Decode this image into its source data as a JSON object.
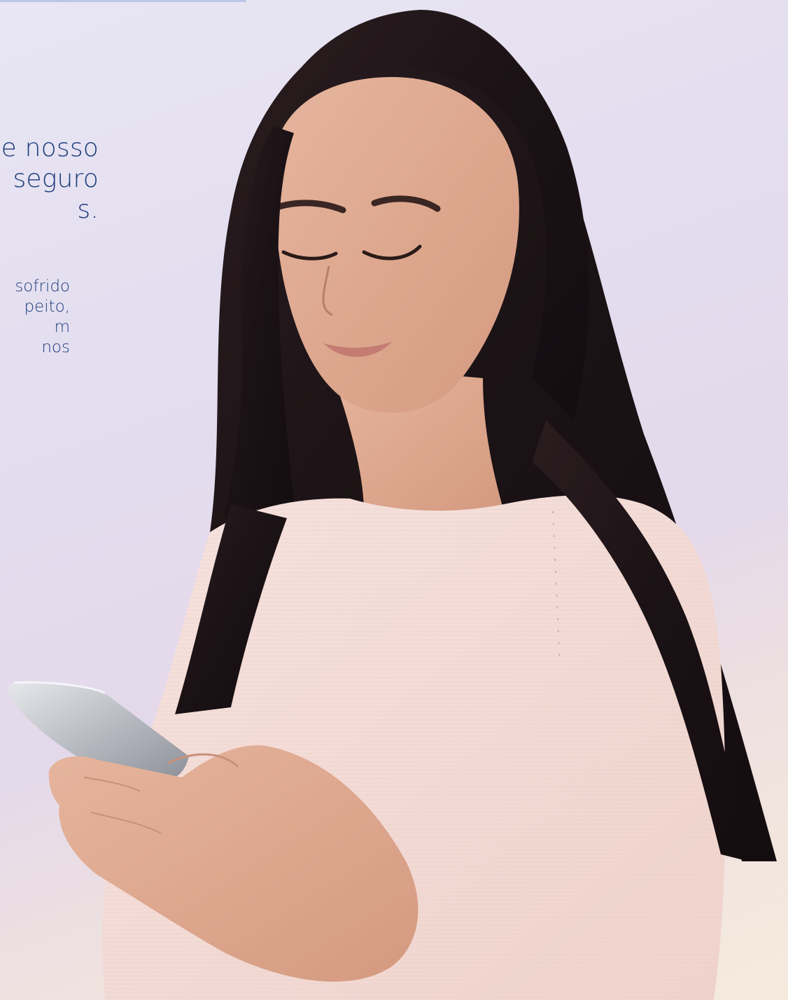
{
  "hero": {
    "heading_lines": [
      "e nosso",
      "seguro",
      "s."
    ],
    "body_lines": [
      "sofrido",
      "peito,",
      "m",
      "nos"
    ]
  },
  "photo": {
    "alt": "woman-using-smartphone-photo"
  },
  "colors": {
    "text_primary": "#1c3b7c",
    "background_top": "#e8e6f3",
    "background_bottom": "#f5ebdd",
    "sweater": "#f6ddd8",
    "hair": "#1e1517"
  }
}
